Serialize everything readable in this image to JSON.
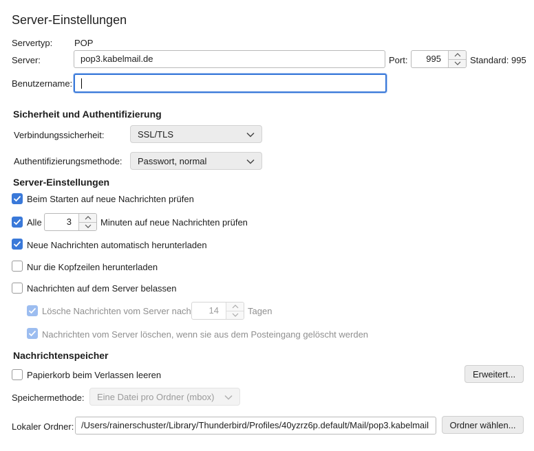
{
  "title": "Server-Einstellungen",
  "server": {
    "type_label": "Servertyp:",
    "type_value": "POP",
    "server_label": "Server:",
    "server_value": "pop3.kabelmail.de",
    "port_label": "Port:",
    "port_value": "995",
    "default_label": "Standard: 995",
    "username_label": "Benutzername:",
    "username_value": ""
  },
  "security": {
    "heading": "Sicherheit und Authentifizierung",
    "connection_label": "Verbindungssicherheit:",
    "connection_value": "SSL/TLS",
    "auth_label": "Authentifizierungsmethode:",
    "auth_value": "Passwort, normal"
  },
  "settings": {
    "heading": "Server-Einstellungen",
    "check_on_start": {
      "label": "Beim Starten auf neue Nachrichten prüfen",
      "checked": true
    },
    "check_every": {
      "prefix": "Alle",
      "minutes": "3",
      "suffix": "Minuten auf neue Nachrichten prüfen",
      "checked": true
    },
    "auto_download": {
      "label": "Neue Nachrichten automatisch herunterladen",
      "checked": true
    },
    "headers_only": {
      "label": "Nur die Kopfzeilen herunterladen",
      "checked": false
    },
    "leave_on_server": {
      "label": "Nachrichten auf dem Server belassen",
      "checked": false
    },
    "delete_after": {
      "prefix": "Lösche Nachrichten vom Server nach",
      "days": "14",
      "suffix": "Tagen",
      "checked": true
    },
    "delete_when_removed": {
      "label": "Nachrichten vom Server löschen, wenn sie aus dem Posteingang gelöscht werden",
      "checked": true
    }
  },
  "storage": {
    "heading": "Nachrichtenspeicher",
    "empty_trash": {
      "label": "Papierkorb beim Verlassen leeren",
      "checked": false
    },
    "advanced_button": "Erweitert...",
    "method_label": "Speichermethode:",
    "method_value": "Eine Datei pro Ordner (mbox)",
    "folder_label": "Lokaler Ordner:",
    "folder_value": "/Users/rainerschuster/Library/Thunderbird/Profiles/40yzrz6p.default/Mail/pop3.kabelmail",
    "choose_folder_button": "Ordner wählen..."
  },
  "colors": {
    "accent": "#3a79d9",
    "accent_disabled": "#9cbdf0"
  },
  "icons": {
    "checkmark": "checkmark-icon",
    "chevron": "chevron-down-icon",
    "spin": "spin-arrows-icon"
  }
}
